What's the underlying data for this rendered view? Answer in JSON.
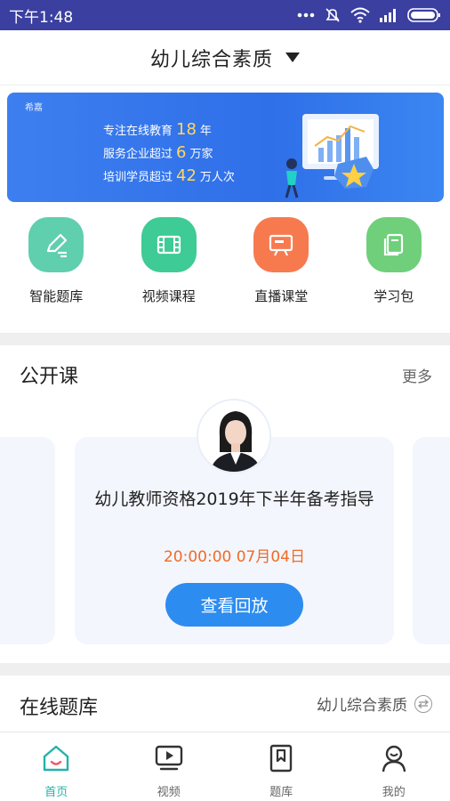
{
  "status_bar": {
    "time": "下午1:48",
    "icons": [
      "more-dots-icon",
      "notification-mute-icon",
      "wifi-icon",
      "signal-icon",
      "battery-icon"
    ]
  },
  "header": {
    "title": "幼儿综合素质",
    "dropdown_icon": "caret-down-icon"
  },
  "banner": {
    "logo_text": "希嘉",
    "lines": [
      {
        "prefix": "专注在线教育",
        "number": "18",
        "suffix": "年"
      },
      {
        "prefix": "服务企业超过",
        "number": "6",
        "suffix": "万家"
      },
      {
        "prefix": "培训学员超过",
        "number": "42",
        "suffix": "万人次"
      }
    ]
  },
  "quick_nav": [
    {
      "label": "智能题库",
      "icon": "pencil-edit-icon",
      "color": "#5fcfae"
    },
    {
      "label": "视频课程",
      "icon": "film-icon",
      "color": "#3ecb95"
    },
    {
      "label": "直播课堂",
      "icon": "live-screen-icon",
      "color": "#f77a4f"
    },
    {
      "label": "学习包",
      "icon": "book-icon",
      "color": "#6fcf7a"
    }
  ],
  "open_class": {
    "title": "公开课",
    "more": "更多",
    "card": {
      "title": "幼儿教师资格2019年下半年备考指导",
      "time": "20:00:00  07月04日",
      "button": "查看回放"
    }
  },
  "online_bank": {
    "title": "在线题库",
    "subject": "幼儿综合素质"
  },
  "bottom_nav": [
    {
      "label": "首页",
      "icon": "home-icon",
      "active": true
    },
    {
      "label": "视频",
      "icon": "video-play-icon",
      "active": false
    },
    {
      "label": "题库",
      "icon": "bookmark-icon",
      "active": false
    },
    {
      "label": "我的",
      "icon": "profile-icon",
      "active": false
    }
  ],
  "colors": {
    "status_bar": "#3a3fa0",
    "accent_teal": "#23b3a9",
    "primary_blue": "#2d8cf0",
    "time_orange": "#f06b25"
  }
}
